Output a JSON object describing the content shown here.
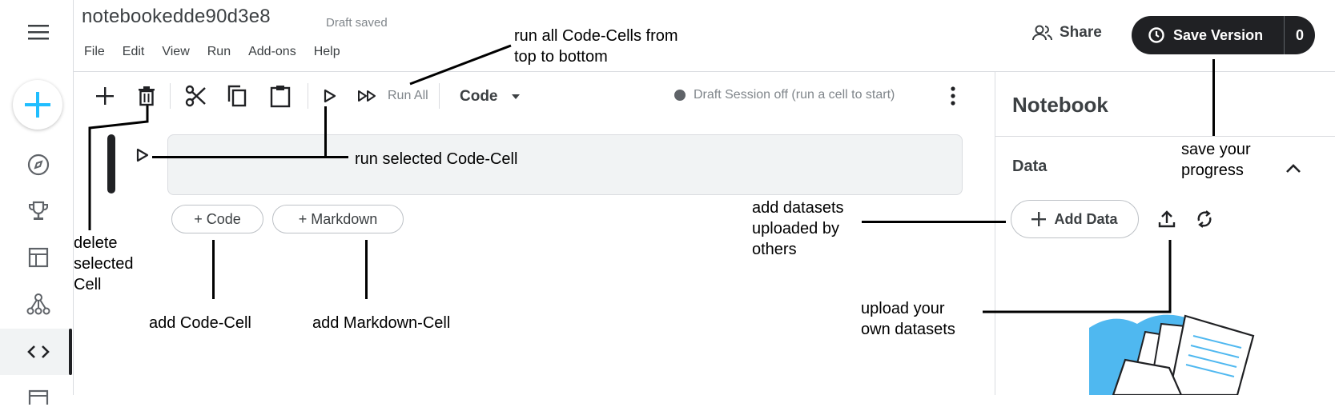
{
  "header": {
    "title": "notebookedde90d3e8",
    "status": "Draft saved",
    "menu": [
      "File",
      "Edit",
      "View",
      "Run",
      "Add-ons",
      "Help"
    ],
    "share_label": "Share",
    "save_version_label": "Save Version",
    "save_version_count": "0"
  },
  "toolbar": {
    "run_all_label": "Run All",
    "cell_type": "Code",
    "session_status": "Draft Session off (run a cell to start)"
  },
  "cell_buttons": {
    "add_code": "+ Code",
    "add_markdown": "+ Markdown"
  },
  "side_panel": {
    "title": "Notebook",
    "section": "Data",
    "add_data_label": "Add Data"
  },
  "annotations": {
    "run_all": [
      "run all Code-Cells from",
      "top to bottom"
    ],
    "run_selected": "run selected Code-Cell",
    "delete": [
      "delete",
      "selected",
      "Cell"
    ],
    "add_code": "add Code-Cell",
    "add_markdown": "add Markdown-Cell",
    "save": [
      "save your",
      "progress"
    ],
    "add_datasets": [
      "add datasets",
      "uploaded by",
      "others"
    ],
    "upload": [
      "upload your",
      "own  datasets"
    ]
  },
  "colors": {
    "dark": "#202124",
    "accent_blue": "#20beff",
    "cell_bg": "#f1f3f4",
    "illustration_blue": "#4fb8f0"
  },
  "icons": [
    "hamburger-icon",
    "plus-icon",
    "compass-icon",
    "trophy-icon",
    "table-icon",
    "network-icon",
    "code-icon",
    "document-icon",
    "share-people-icon",
    "history-icon",
    "add-icon",
    "trash-icon",
    "scissors-icon",
    "copy-icon",
    "paste-icon",
    "play-icon",
    "fast-forward-icon",
    "caret-down-icon",
    "more-vert-icon",
    "chevron-up-icon",
    "upload-icon",
    "sync-icon"
  ]
}
